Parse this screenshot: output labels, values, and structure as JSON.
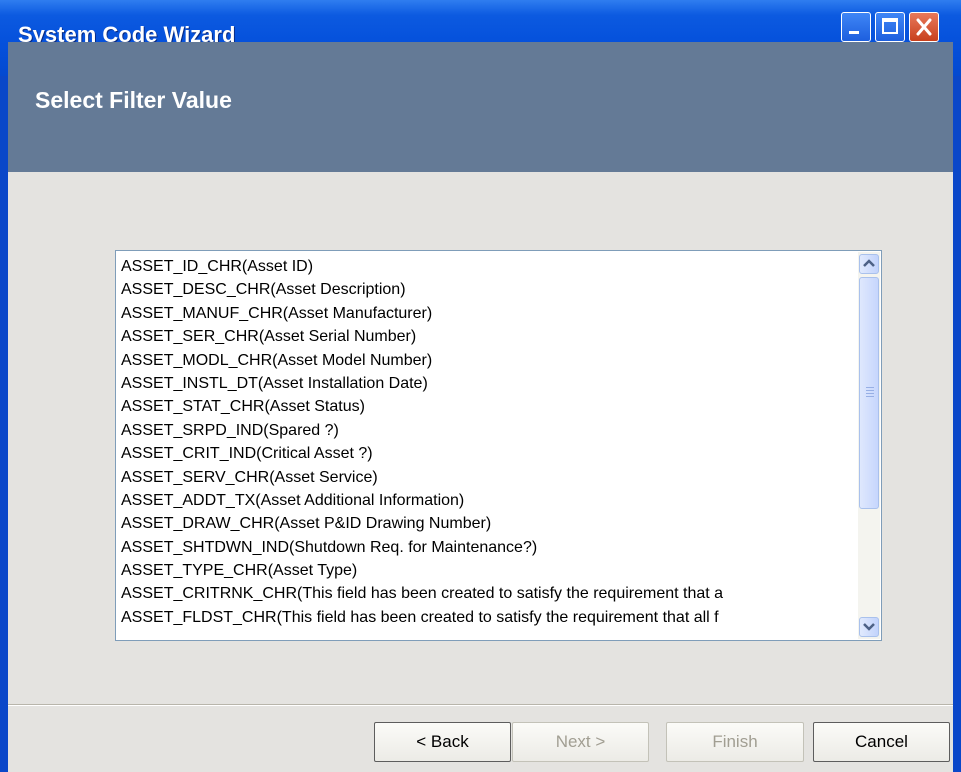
{
  "window": {
    "title": "System Code Wizard"
  },
  "header": {
    "title": "Select Filter Value"
  },
  "list": {
    "items": [
      "ASSET_ID_CHR(Asset ID)",
      "ASSET_DESC_CHR(Asset Description)",
      "ASSET_MANUF_CHR(Asset Manufacturer)",
      "ASSET_SER_CHR(Asset Serial Number)",
      "ASSET_MODL_CHR(Asset Model Number)",
      "ASSET_INSTL_DT(Asset Installation Date)",
      "ASSET_STAT_CHR(Asset Status)",
      "ASSET_SRPD_IND(Spared ?)",
      "ASSET_CRIT_IND(Critical Asset ?)",
      "ASSET_SERV_CHR(Asset Service)",
      "ASSET_ADDT_TX(Asset Additional Information)",
      "ASSET_DRAW_CHR(Asset P&ID Drawing Number)",
      "ASSET_SHTDWN_IND(Shutdown Req. for Maintenance?)",
      "ASSET_TYPE_CHR(Asset Type)",
      "ASSET_CRITRNK_CHR(This field has been created to satisfy the requirement that a",
      "ASSET_FLDST_CHR(This field has been created to satisfy the requirement that all f"
    ]
  },
  "buttons": {
    "back": "< Back",
    "next": "Next >",
    "finish": "Finish",
    "cancel": "Cancel"
  }
}
